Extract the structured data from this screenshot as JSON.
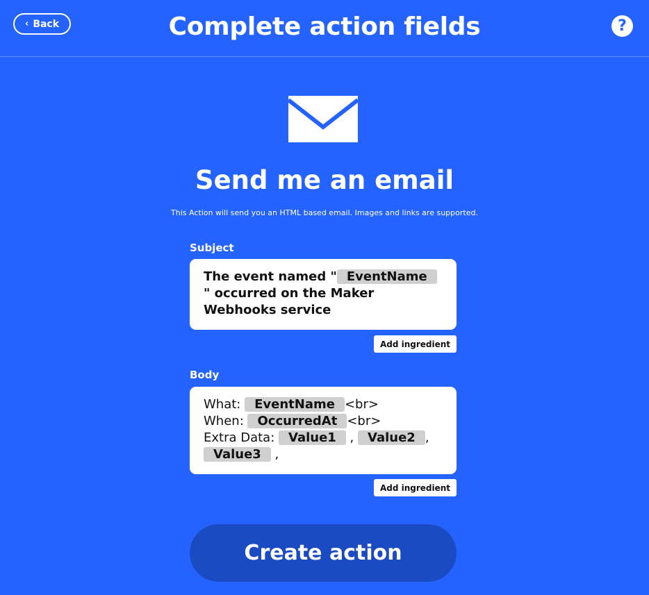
{
  "header": {
    "back_label": "Back",
    "title": "Complete action fields",
    "help_glyph": "?"
  },
  "action": {
    "icon": "envelope-icon",
    "title": "Send me an email",
    "description": "This Action will send you an HTML based email. Images and links are supported."
  },
  "subject": {
    "label": "Subject",
    "prefix": "The event named \"",
    "ingredient": "EventName",
    "suffix": "\"",
    "rest": "occurred on the Maker Webhooks service",
    "add_ingredient_label": "Add ingredient"
  },
  "body": {
    "label": "Body",
    "what_label": "What: ",
    "what_ingredient": "EventName",
    "br1": "<br>",
    "when_label": "When: ",
    "when_ingredient": "OccurredAt",
    "br2": "<br>",
    "extra_label": "Extra Data: ",
    "value1": "Value1",
    "sep1": ",",
    "value2": "Value2",
    "sep2": ",",
    "value3": "Value3",
    "sep3": ",",
    "add_ingredient_label": "Add ingredient"
  },
  "create_label": "Create action",
  "colors": {
    "background": "#2463ff",
    "button": "#1a4bc2",
    "chip": "#cfcfcf"
  }
}
